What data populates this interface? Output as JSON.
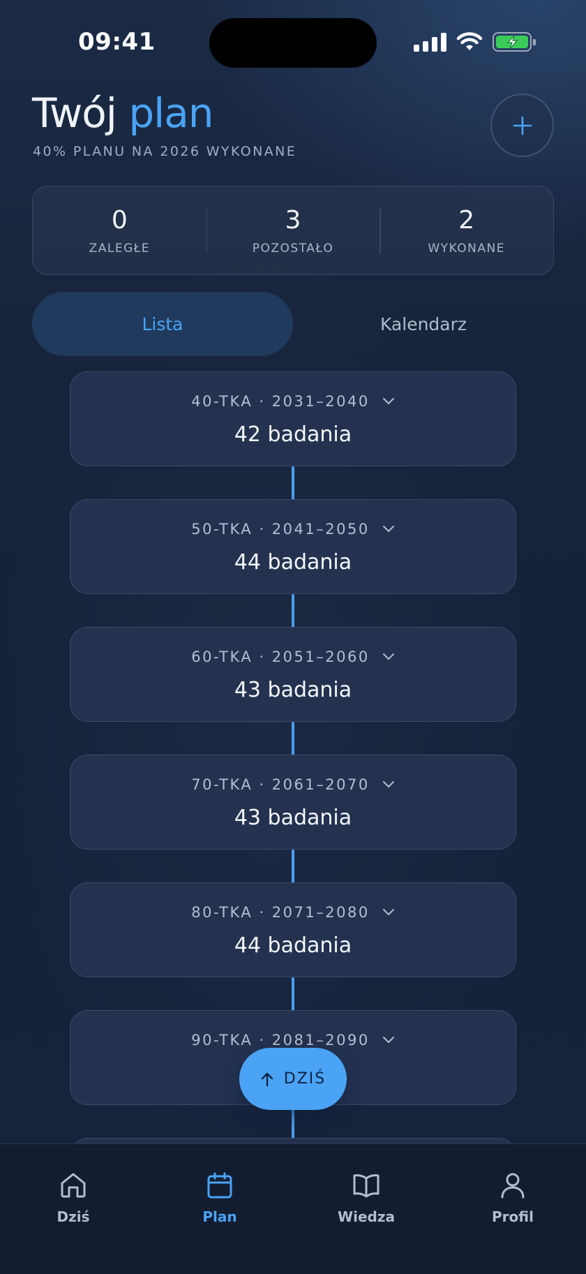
{
  "status_bar": {
    "time": "09:41"
  },
  "header": {
    "title_main": "Twój",
    "title_accent": "plan",
    "subtitle": "40% PLANU NA 2026 WYKONANE"
  },
  "stats": [
    {
      "value": "0",
      "label": "ZALEGŁE"
    },
    {
      "value": "3",
      "label": "POZOSTAŁO"
    },
    {
      "value": "2",
      "label": "WYKONANE"
    }
  ],
  "tabs": [
    {
      "label": "Lista",
      "active": true
    },
    {
      "label": "Kalendarz",
      "active": false
    }
  ],
  "decades": [
    {
      "label": "40-TKA · 2031–2040",
      "count": "42 badania"
    },
    {
      "label": "50-TKA · 2041–2050",
      "count": "44 badania"
    },
    {
      "label": "60-TKA · 2051–2060",
      "count": "43 badania"
    },
    {
      "label": "70-TKA · 2061–2070",
      "count": "43 badania"
    },
    {
      "label": "80-TKA · 2071–2080",
      "count": "44 badania"
    },
    {
      "label": "90-TKA · 2081–2090",
      "count": ""
    }
  ],
  "today_button": {
    "label": "DZIŚ"
  },
  "bottom_nav": [
    {
      "label": "Dziś",
      "icon": "home-icon",
      "active": false
    },
    {
      "label": "Plan",
      "icon": "calendar-icon",
      "active": true
    },
    {
      "label": "Wiedza",
      "icon": "book-icon",
      "active": false
    },
    {
      "label": "Profil",
      "icon": "user-icon",
      "active": false
    }
  ],
  "colors": {
    "accent": "#4aa3f5",
    "background": "#17233a",
    "card": "#243250",
    "nav_background": "#131d31"
  }
}
